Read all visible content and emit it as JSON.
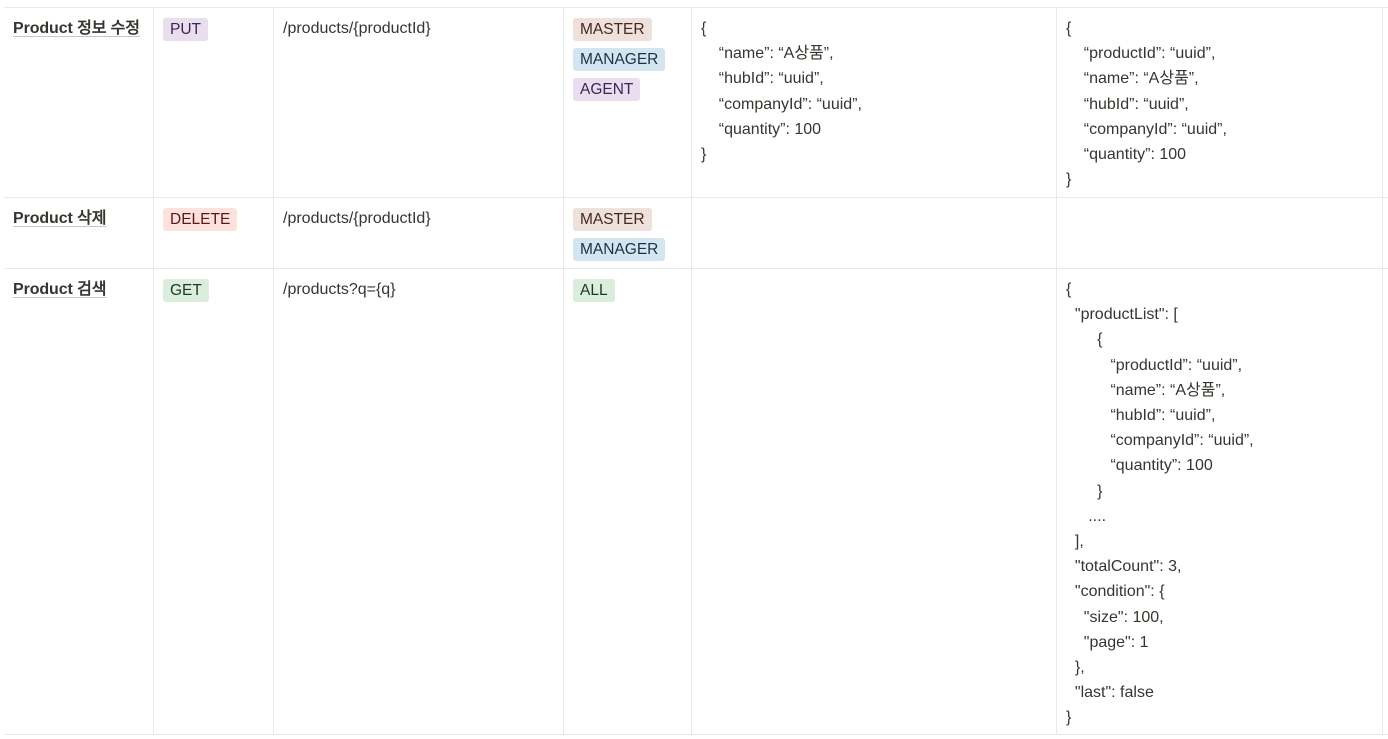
{
  "rows": [
    {
      "name": "Product 정보 수정",
      "method": "PUT",
      "path": "/products/{productId}",
      "roles": [
        "MASTER",
        "MANAGER",
        "AGENT"
      ],
      "request": "{\n    “name”: “A상품”,\n    “hubId”: “uuid”,\n    “companyId”: “uuid”,\n    “quantity”: 100\n}",
      "response": "{\n    “productId”: “uuid”,\n    “name”: “A상품”,\n    “hubId”: “uuid”,\n    “companyId”: “uuid”,\n    “quantity”: 100\n}"
    },
    {
      "name": "Product 삭제",
      "method": "DELETE",
      "path": "/products/{productId}",
      "roles": [
        "MASTER",
        "MANAGER"
      ],
      "request": "",
      "response": ""
    },
    {
      "name": "Product 검색",
      "method": "GET",
      "path": "/products?q={q}",
      "roles": [
        "ALL"
      ],
      "request": "",
      "response": "{\n  \"productList\": [\n       {\n          “productId”: “uuid”,\n          “name”: “A상품”,\n          “hubId”: “uuid”,\n          “companyId”: “uuid”,\n          “quantity”: 100\n       }\n     ....\n  ],\n  \"totalCount\": 3,\n  \"condition\": {\n    \"size\": 100,\n    \"page\": 1\n  },\n  \"last\": false\n}"
    }
  ],
  "colors": {
    "border": "#e9e9e7",
    "text": "#37352f",
    "tag_purple_bg": "#e8deee",
    "tag_red_bg": "#ffe2dd",
    "tag_green_bg": "#dbeddb",
    "tag_brown_bg": "#eee0da",
    "tag_blue_bg": "#d3e5ef"
  }
}
